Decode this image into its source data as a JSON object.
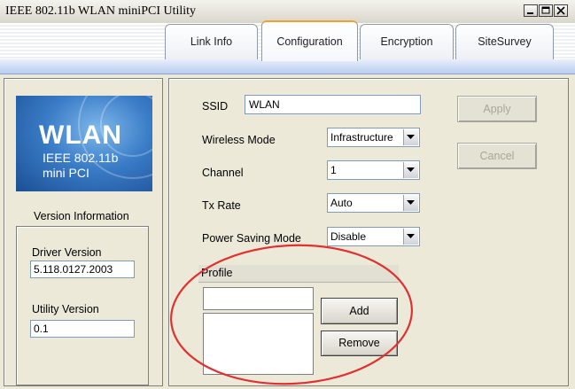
{
  "window": {
    "title": "IEEE 802.11b WLAN miniPCI Utility"
  },
  "tabs": [
    {
      "label": "Link Info",
      "active": false
    },
    {
      "label": "Configuration",
      "active": true
    },
    {
      "label": "Encryption",
      "active": false
    },
    {
      "label": "SiteSurvey",
      "active": false
    }
  ],
  "logo": {
    "title": "WLAN",
    "line1": "IEEE 802.11b",
    "line2": "mini PCI"
  },
  "version_info": {
    "heading": "Version Information",
    "driver_label": "Driver Version",
    "driver_value": "5.118.0127.2003",
    "utility_label": "Utility Version",
    "utility_value": "0.1"
  },
  "config": {
    "ssid_label": "SSID",
    "ssid_value": "WLAN",
    "wireless_mode_label": "Wireless Mode",
    "wireless_mode_value": "Infrastructure",
    "channel_label": "Channel",
    "channel_value": "1",
    "tx_rate_label": "Tx Rate",
    "tx_rate_value": "Auto",
    "power_saving_label": "Power Saving Mode",
    "power_saving_value": "Disable"
  },
  "buttons": {
    "apply": "Apply",
    "cancel": "Cancel",
    "add": "Add",
    "remove": "Remove"
  },
  "profile": {
    "label": "Profile",
    "input_value": "",
    "items": []
  },
  "colors": {
    "highlight_ellipse": "#e03030",
    "tab_active_accent": "#f0a030"
  }
}
